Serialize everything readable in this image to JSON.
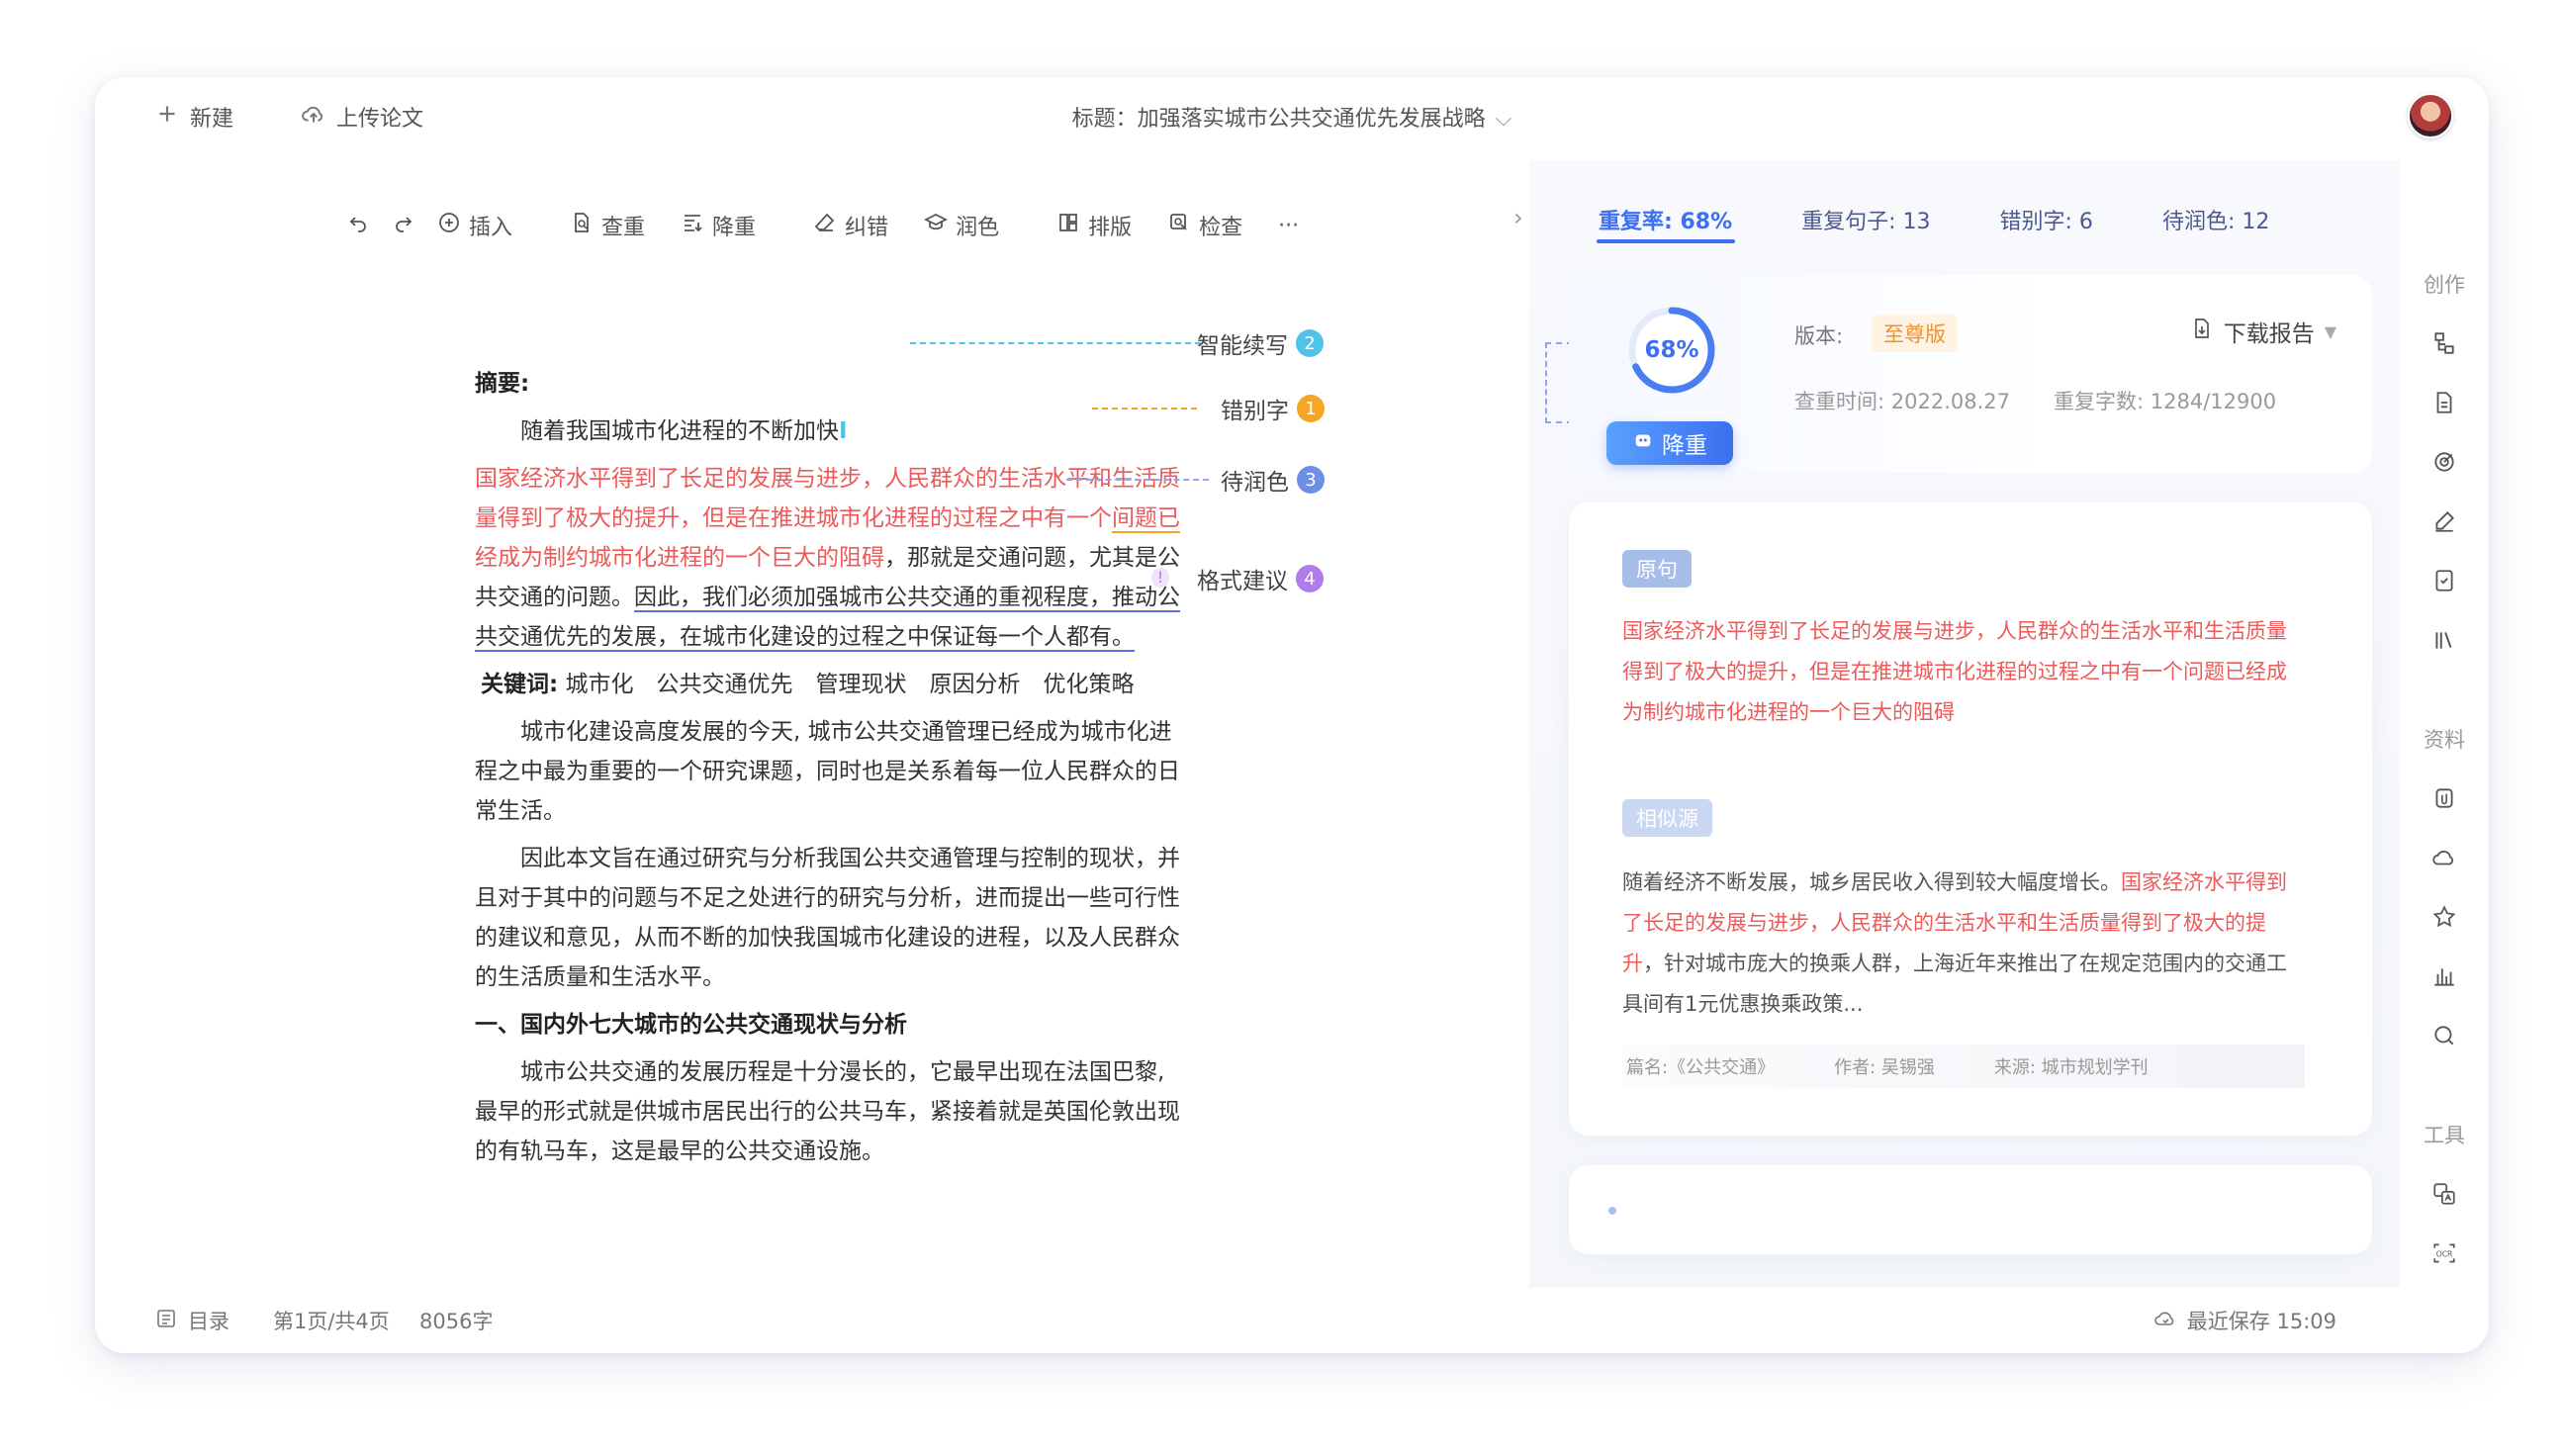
{
  "topbar": {
    "new_label": "新建",
    "upload_label": "上传论文",
    "title_text": "标题：加强落实城市公共交通优先发展战略"
  },
  "toolbar": {
    "insert": "插入",
    "check_dup": "查重",
    "reduce_dup": "降重",
    "correct": "纠错",
    "polish": "润色",
    "layout": "排版",
    "inspect": "检查",
    "more": "···"
  },
  "document": {
    "abstract_heading": "摘要:",
    "p1": "随着我国城市化进程的不断加快",
    "p2_red1": "国家经济水平得到了长足的发展与进步，人民群众的生活水平和生活质量得到了极大的提升，但是在推进城市化进程的过程之中有一个",
    "p2_red_typo": "间题已",
    "p2_red2": "经成为制约城市化进程的一个巨大的阻碍",
    "p2_normal": "，那就是交通问题，尤其是公共交通的问题。",
    "p2_under": "因此，我们必须加强城市公共交通的重视程度，推动公共交通优先的发展，在城市化建设的过程之中保证每一个人都有。",
    "keywords_label": "关键词:",
    "keywords": "城市化　公共交通优先　管理现状　原因分析　优化策略",
    "p3": "城市化建设高度发展的今天, 城市公共交通管理已经成为城市化进程之中最为重要的一个研究课题，同时也是关系着每一位人民群众的日常生活。",
    "p4": "因此本文旨在通过研究与分析我国公共交通管理与控制的现状，并且对于其中的问题与不足之处进行的研究与分析，进而提出一些可行性的建议和意见，从而不断的加快我国城市化建设的进程，以及人民群众的生活质量和生活水平。",
    "heading1": "一、国内外七大城市的公共交通现状与分析",
    "p5": "城市公共交通的发展历程是十分漫长的，它最早出现在法国巴黎,最早的形式就是供城市居民出行的公共马车，紧接着就是英国伦敦出现的有轨马车，这是最早的公共交通设施。"
  },
  "annotations": [
    {
      "label": "智能续写",
      "count": "2",
      "color": "#4fc3e8"
    },
    {
      "label": "错别字",
      "count": "1",
      "color": "#f5a623"
    },
    {
      "label": "待润色",
      "count": "3",
      "color": "#6f8ee8"
    },
    {
      "label": "格式建议",
      "count": "4",
      "color": "#b07ce8"
    }
  ],
  "statusbar": {
    "toc": "目录",
    "page_info": "第1页/共4页",
    "word_count": "8056字",
    "save_info": "最近保存 15:09"
  },
  "stats": {
    "dup_rate": "重复率: 68%",
    "dup_sentences": "重复句子: 13",
    "typos": "错别字: 6",
    "to_polish": "待润色: 12"
  },
  "summary": {
    "percent": "68%",
    "percent_value": 0.68,
    "reduce_btn": "降重",
    "version_label": "版本:",
    "version": "至尊版",
    "download": "下载报告",
    "check_time": "查重时间: 2022.08.27",
    "dup_count": "重复字数: 1284/12900"
  },
  "detail": {
    "orig_tag": "原句",
    "orig_text": "国家经济水平得到了长足的发展与进步，人民群众的生活水平和生活质量得到了极大的提升，但是在推进城市化进程的过程之中有一个问题已经成为制约城市化进程的一个巨大的阻碍",
    "similar_tag": "相似源",
    "similar_normal1": "随着经济不断发展，城乡居民收入得到较大幅度增长。",
    "similar_red": "国家经济水平得到了长足的发展与进步，人民群众的生活水平和生活质量得到了极大的提升",
    "similar_normal2": "，针对城市庞大的换乘人群，上海近年来推出了在规定范围内的交通工具间有1元优惠换乘政策...",
    "source_title": "篇名:《公共交通》",
    "source_author": "作者: 吴锡强",
    "source_origin": "来源: 城市规划学刊"
  },
  "sidebar": {
    "create": "创作",
    "materials": "资料",
    "tools": "工具"
  },
  "colors": {
    "accent": "#3d6ff0",
    "red": "#ec5a5a",
    "orange": "#f5a623"
  }
}
